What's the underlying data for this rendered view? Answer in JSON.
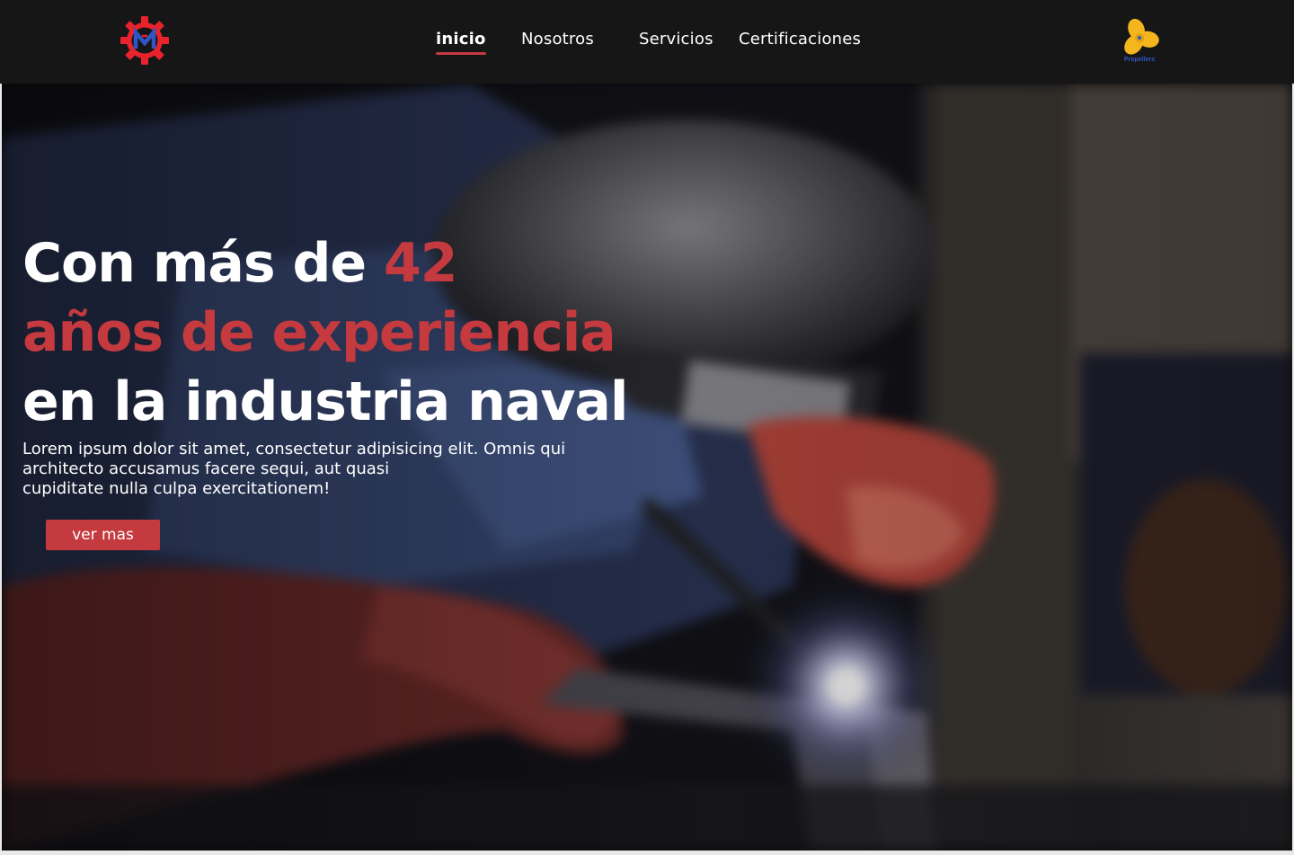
{
  "header": {
    "brand_logo": "company-gear-logo",
    "nav": [
      {
        "label": "inicio",
        "active": true
      },
      {
        "label": "Nosotros",
        "active": false
      },
      {
        "label": "Servicios",
        "active": false
      },
      {
        "label": "Certificaciones",
        "active": false
      }
    ],
    "partner_logo": {
      "icon": "propeller-logo",
      "text": "Propellers"
    }
  },
  "hero": {
    "headline": {
      "line1_white": "Con más de ",
      "line1_accent": "42",
      "line2_accent": "años de experiencia",
      "line3_white": "en la industria naval"
    },
    "description_lines": [
      "Lorem ipsum dolor sit amet, consectetur adipisicing elit. Omnis qui",
      "architecto accusamus facere sequi, aut quasi",
      "cupiditate nulla culpa exercitationem!"
    ],
    "cta_label": "ver mas",
    "background_image": "welder-at-work-photo"
  },
  "colors": {
    "header_bg": "#161617",
    "accent": "#c43a3f",
    "text": "#ffffff",
    "propeller_yellow": "#f5b51c",
    "logo_blue": "#2f56c4"
  }
}
